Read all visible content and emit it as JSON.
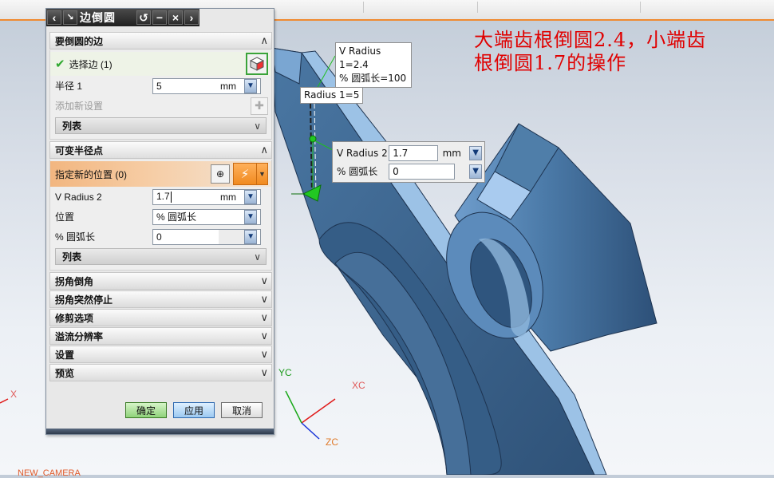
{
  "dialog": {
    "title": "边倒圆",
    "sections": {
      "edge": {
        "title": "要倒圆的边",
        "select_edge_label": "选择边 (1)",
        "radius_label": "半径 1",
        "radius_value": "5",
        "radius_unit": "mm",
        "add_new_set_label": "添加新设置",
        "list_label": "列表"
      },
      "variable_radius": {
        "title": "可变半径点",
        "specify_location_label": "指定新的位置 (0)",
        "v_radius_label": "V Radius 2",
        "v_radius_value": "1.7",
        "v_radius_unit": "mm",
        "location_label": "位置",
        "location_value": "% 圆弧长",
        "arc_length_label": "% 圆弧长",
        "arc_length_value": "0",
        "list_label": "列表"
      }
    },
    "collapsed_sections": [
      "拐角倒角",
      "拐角突然停止",
      "修剪选项",
      "溢流分辨率",
      "设置",
      "预览"
    ],
    "buttons": {
      "ok": "确定",
      "apply": "应用",
      "cancel": "取消"
    }
  },
  "callouts": {
    "vr1_line1": "V Radius 1=2.4",
    "vr1_line2": "% 圆弧长=100",
    "radius1": "Radius 1=5",
    "vr2_label": "V Radius 2",
    "vr2_value": "1.7",
    "vr2_unit": "mm",
    "arc_label": "% 圆弧长",
    "arc_value": "0"
  },
  "annotation": {
    "line1": "大端齿根倒圆2.4，小端齿",
    "line2": "根倒圆1.7的操作"
  },
  "axes": {
    "yc": "YC",
    "xc": "XC",
    "zc": "ZC",
    "x": "X"
  },
  "camera_label": "NEW_CAMERA",
  "colors": {
    "part": "#3e6891",
    "part_light": "#8fb6dc",
    "annotation": "#e00000",
    "accent": "#f08a30"
  }
}
